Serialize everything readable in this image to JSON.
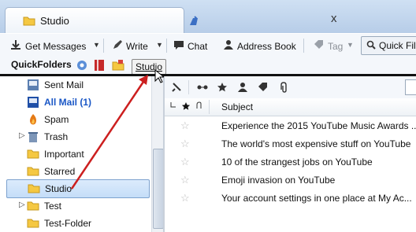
{
  "window": {
    "tab_title": "Studio",
    "close_glyph": "x"
  },
  "toolbar": {
    "get_messages": "Get Messages",
    "write": "Write",
    "chat": "Chat",
    "address_book": "Address Book",
    "tag": "Tag",
    "quick_filter": "Quick Fil"
  },
  "quickfolders": {
    "label": "QuickFolders",
    "studio": "Studio"
  },
  "folders": [
    {
      "label": "Sent Mail",
      "icon": "sent-mail-icon"
    },
    {
      "label": "All Mail (1)",
      "icon": "all-mail-icon",
      "style": "unread"
    },
    {
      "label": "Spam",
      "icon": "spam-icon"
    },
    {
      "label": "Trash",
      "icon": "trash-icon",
      "expandable": true
    },
    {
      "label": "Important",
      "icon": "folder-icon"
    },
    {
      "label": "Starred",
      "icon": "folder-icon"
    },
    {
      "label": "Studio",
      "icon": "folder-icon",
      "selected": true
    },
    {
      "label": "Test",
      "icon": "folder-icon",
      "expandable": true
    },
    {
      "label": "Test-Folder",
      "icon": "folder-icon"
    }
  ],
  "message_list": {
    "columns": {
      "subject": "Subject"
    },
    "rows": [
      {
        "subject": "Experience the 2015 YouTube Music Awards ..."
      },
      {
        "subject": "The world's most expensive stuff on YouTube"
      },
      {
        "subject": "10 of the strangest jobs on YouTube"
      },
      {
        "subject": "Emoji invasion on YouTube"
      },
      {
        "subject": "Your account settings in one place at My Ac..."
      }
    ]
  },
  "colors": {
    "accent": "#1a57c6",
    "arrow": "#cc1f1f",
    "folder": "#f5c842"
  }
}
